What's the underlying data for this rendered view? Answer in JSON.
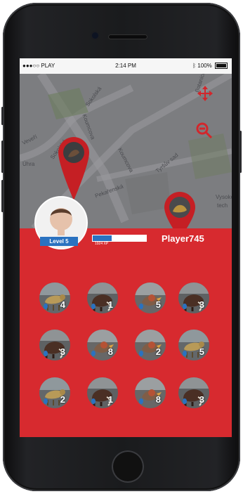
{
  "status_bar": {
    "carrier": "●●●○○ PLAY",
    "time": "2:14 PM",
    "battery": "100%"
  },
  "map": {
    "streets": [
      "Sokolská",
      "Koumcova",
      "Botanická",
      "Veveří",
      "Úhra",
      "Sokolská",
      "Koumcova",
      "Tyršův sad",
      "Pekařenská",
      "Vysoké",
      "tech"
    ]
  },
  "profile": {
    "level": "Level 5",
    "xp_text": "1924 XP",
    "xp_fraction": 0.35,
    "player": "Player745"
  },
  "tokens": [
    {
      "count": "4",
      "type": "tiger"
    },
    {
      "count": "1",
      "type": "mammoth"
    },
    {
      "count": "5",
      "type": "bird"
    },
    {
      "count": "3",
      "type": "mammoth"
    },
    {
      "count": "3",
      "type": "mammoth"
    },
    {
      "count": "8",
      "type": "bird"
    },
    {
      "count": "2",
      "type": "bird"
    },
    {
      "count": "5",
      "type": "tiger"
    },
    {
      "count": "2",
      "type": "tiger"
    },
    {
      "count": "1",
      "type": "mammoth"
    },
    {
      "count": "8",
      "type": "bird"
    },
    {
      "count": "3",
      "type": "mammoth"
    }
  ],
  "colors": {
    "red": "#d72a2f",
    "blue": "#2a72c0"
  }
}
